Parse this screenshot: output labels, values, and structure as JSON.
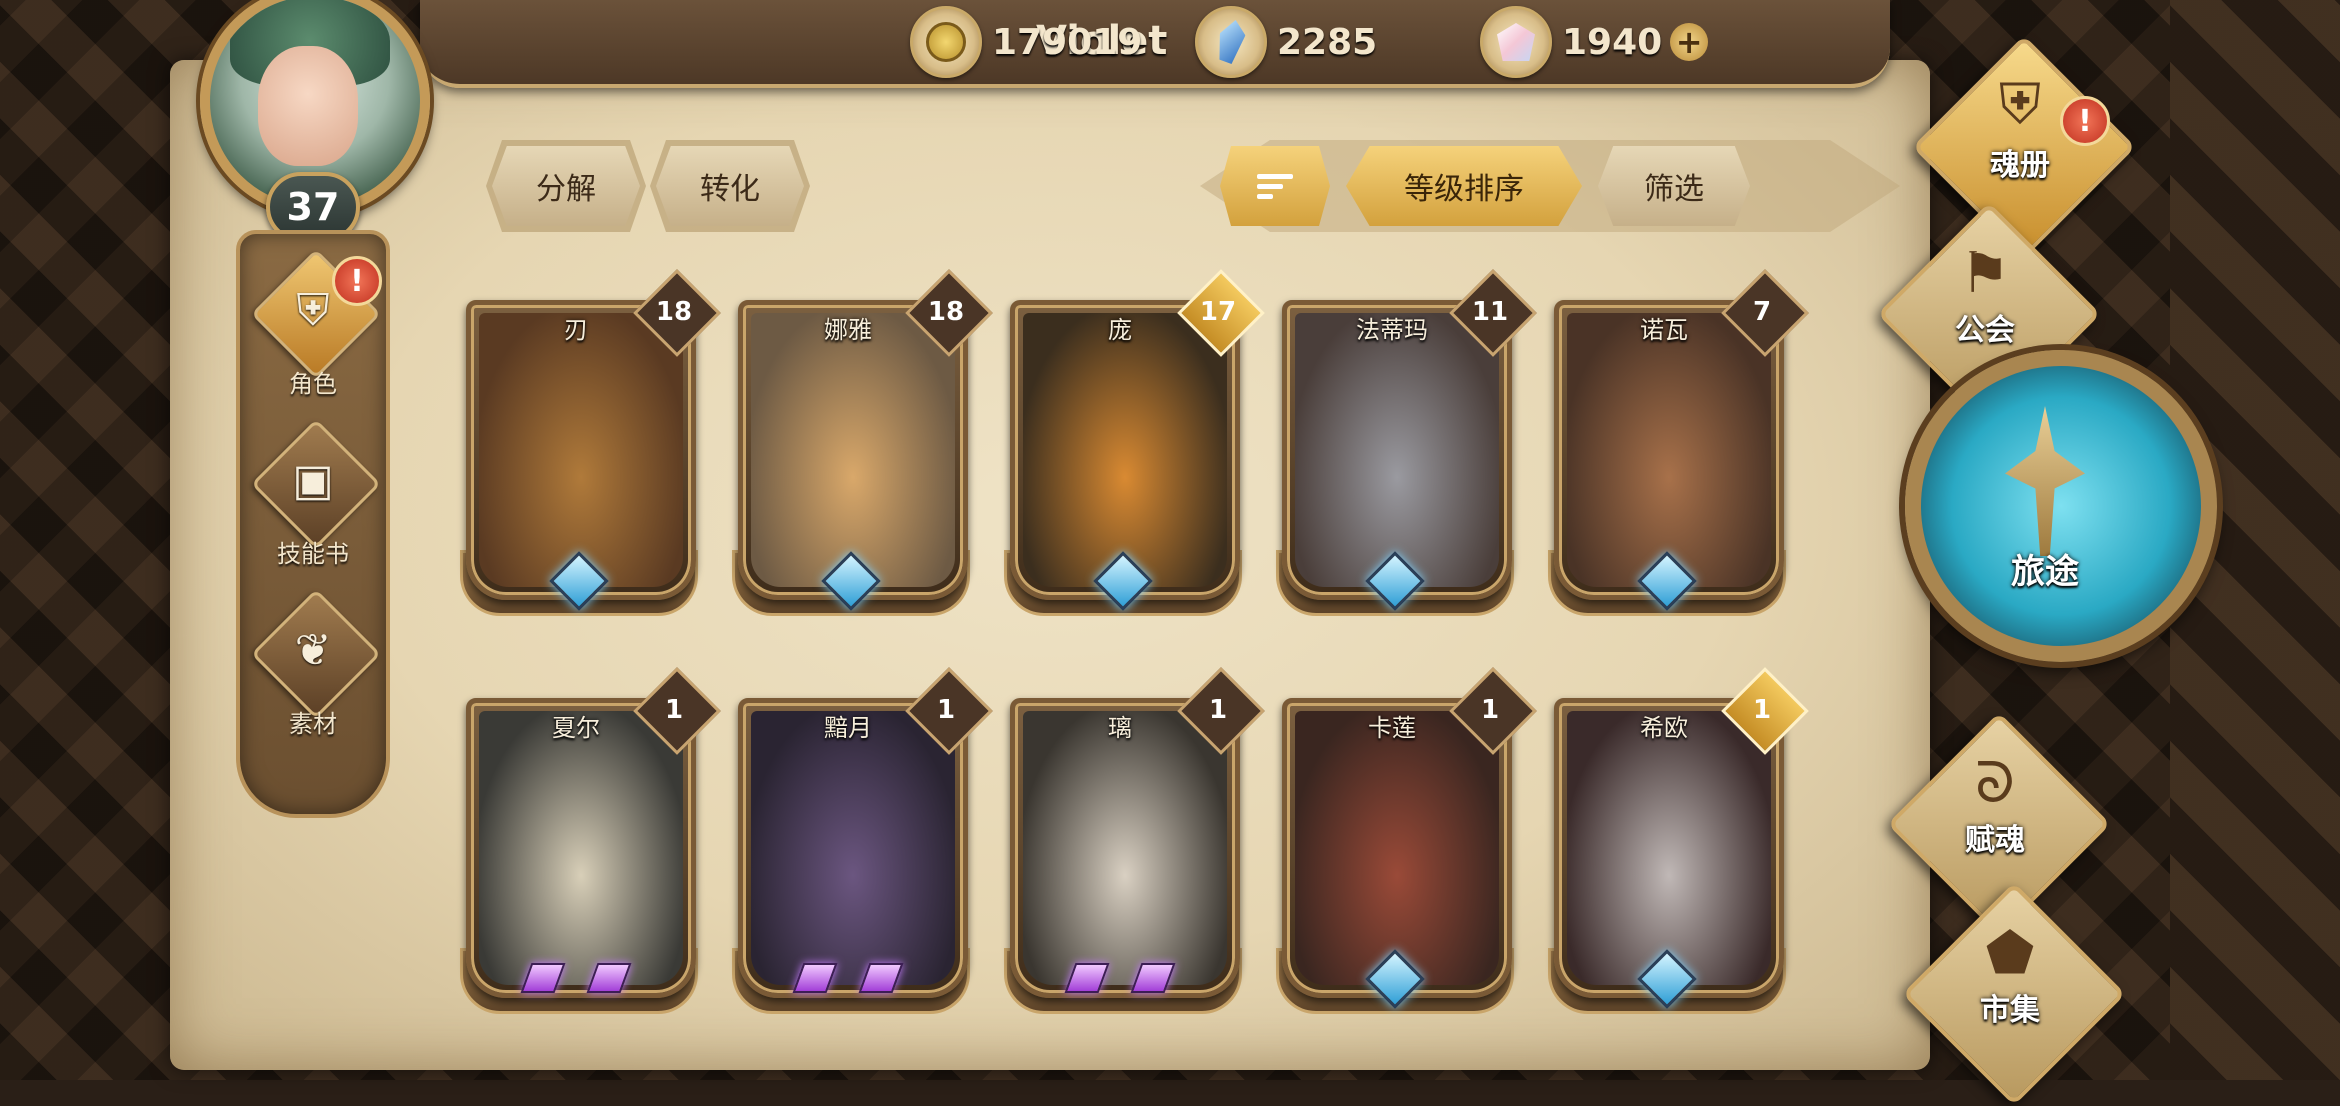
{
  "player": {
    "name": "Violet",
    "level": "37"
  },
  "currencies": [
    {
      "icon": "gold-coin-icon",
      "value": "179019",
      "has_plus": false
    },
    {
      "icon": "blue-crystal-icon",
      "value": "2285",
      "has_plus": false
    },
    {
      "icon": "pink-gem-icon",
      "value": "1940",
      "has_plus": true
    }
  ],
  "plus_label": "+",
  "sidenav": [
    {
      "label": "角色",
      "icon": "character-icon",
      "alert": "!"
    },
    {
      "label": "技能书",
      "icon": "skill-book-icon",
      "alert": ""
    },
    {
      "label": "素材",
      "icon": "material-icon",
      "alert": ""
    }
  ],
  "toolbar": {
    "decompose": "分解",
    "convert": "转化",
    "sort_order": "等级排序",
    "filter": "筛选"
  },
  "cards": [
    {
      "name": "刃",
      "level": "18",
      "rarity": "blue",
      "gold_tag": false,
      "art": [
        "#5a3a22",
        "#b07a3a"
      ]
    },
    {
      "name": "娜雅",
      "level": "18",
      "rarity": "blue",
      "gold_tag": false,
      "art": [
        "#6d5a44",
        "#d9a86a"
      ]
    },
    {
      "name": "庞",
      "level": "17",
      "rarity": "blue",
      "gold_tag": true,
      "art": [
        "#3b2e1e",
        "#d98a32"
      ]
    },
    {
      "name": "法蒂玛",
      "level": "11",
      "rarity": "blue",
      "gold_tag": false,
      "art": [
        "#4a3e3a",
        "#9a9aa0"
      ]
    },
    {
      "name": "诺瓦",
      "level": "7",
      "rarity": "blue",
      "gold_tag": false,
      "art": [
        "#4a3326",
        "#a8714a"
      ]
    },
    {
      "name": "夏尔",
      "level": "1",
      "rarity": "purple",
      "gold_tag": false,
      "art": [
        "#3a3a36",
        "#d8cfb8"
      ]
    },
    {
      "name": "黯月",
      "level": "1",
      "rarity": "purple",
      "gold_tag": false,
      "art": [
        "#2a2432",
        "#6b5680"
      ]
    },
    {
      "name": "璃",
      "level": "1",
      "rarity": "purple",
      "gold_tag": false,
      "art": [
        "#3a3630",
        "#d9d0c2"
      ]
    },
    {
      "name": "卡莲",
      "level": "1",
      "rarity": "blue",
      "gold_tag": false,
      "art": [
        "#3a2620",
        "#9a4a38"
      ]
    },
    {
      "name": "希欧",
      "level": "1",
      "rarity": "blue",
      "gold_tag": true,
      "art": [
        "#3a2a2a",
        "#c0b8b6"
      ]
    }
  ],
  "right_nav": {
    "soul_book": {
      "label": "魂册",
      "alert": "!"
    },
    "guild": {
      "label": "公会"
    },
    "journey": {
      "label": "旅途"
    },
    "fuhun": {
      "label": "赋魂"
    },
    "market": {
      "label": "市集"
    }
  }
}
